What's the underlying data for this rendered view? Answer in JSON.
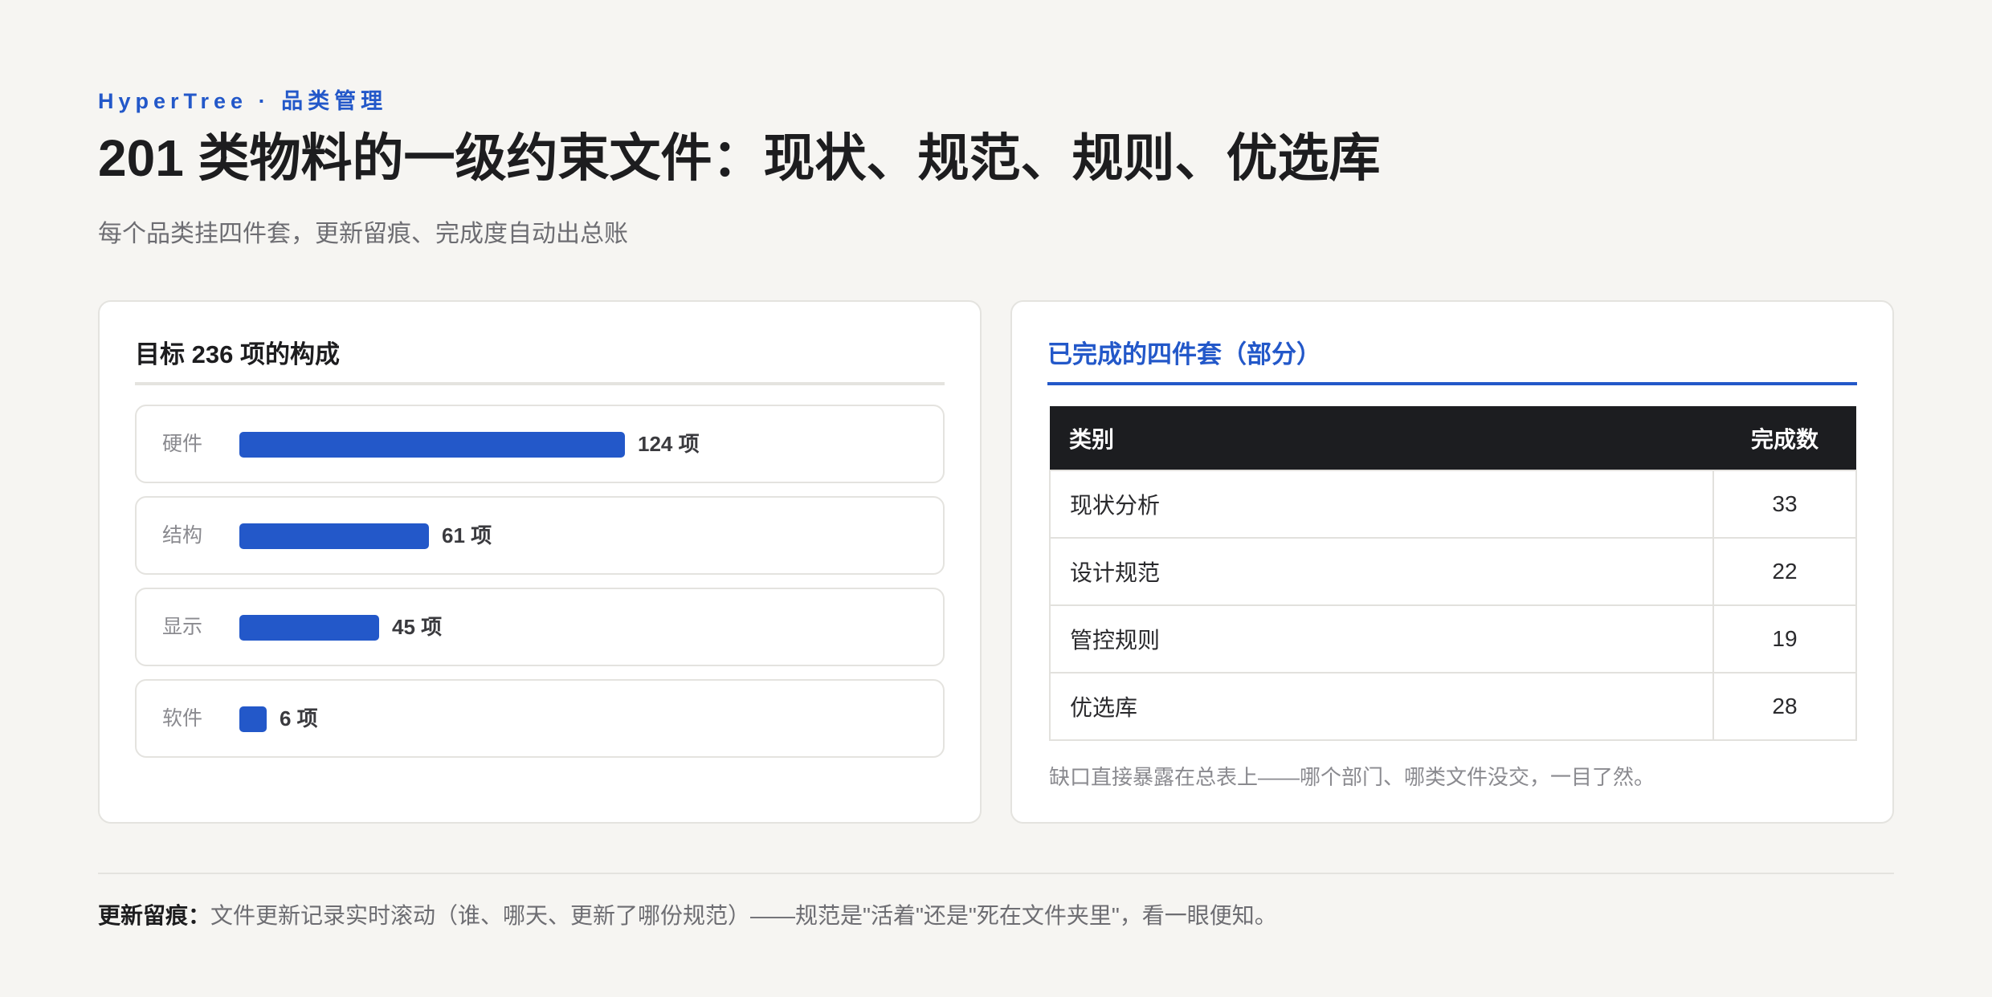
{
  "header": {
    "eyebrow": "HyperTree · 品类管理",
    "title": "201 类物料的一级约束文件：现状、规范、规则、优选库",
    "subtitle": "每个品类挂四件套，更新留痕、完成度自动出总账"
  },
  "left_card": {
    "title": "目标 236 项的构成",
    "max": 124,
    "bars": [
      {
        "label": "硬件",
        "value": 124,
        "value_text": "124 项"
      },
      {
        "label": "结构",
        "value": 61,
        "value_text": "61 项"
      },
      {
        "label": "显示",
        "value": 45,
        "value_text": "45 项"
      },
      {
        "label": "软件",
        "value": 6,
        "value_text": "6 项"
      }
    ]
  },
  "right_card": {
    "title": "已完成的四件套（部分）",
    "columns": [
      "类别",
      "完成数"
    ],
    "rows": [
      {
        "category": "现状分析",
        "count": "33"
      },
      {
        "category": "设计规范",
        "count": "22"
      },
      {
        "category": "管控规则",
        "count": "19"
      },
      {
        "category": "优选库",
        "count": "28"
      }
    ],
    "note": "缺口直接暴露在总表上——哪个部门、哪类文件没交，一目了然。"
  },
  "footer": {
    "label": "更新留痕：",
    "text": "文件更新记录实时滚动（谁、哪天、更新了哪份规范）——规范是\"活着\"还是\"死在文件夹里\"，看一眼便知。"
  },
  "colors": {
    "accent": "#2358c9",
    "background": "#f6f5f2",
    "table_header": "#1c1d20"
  }
}
